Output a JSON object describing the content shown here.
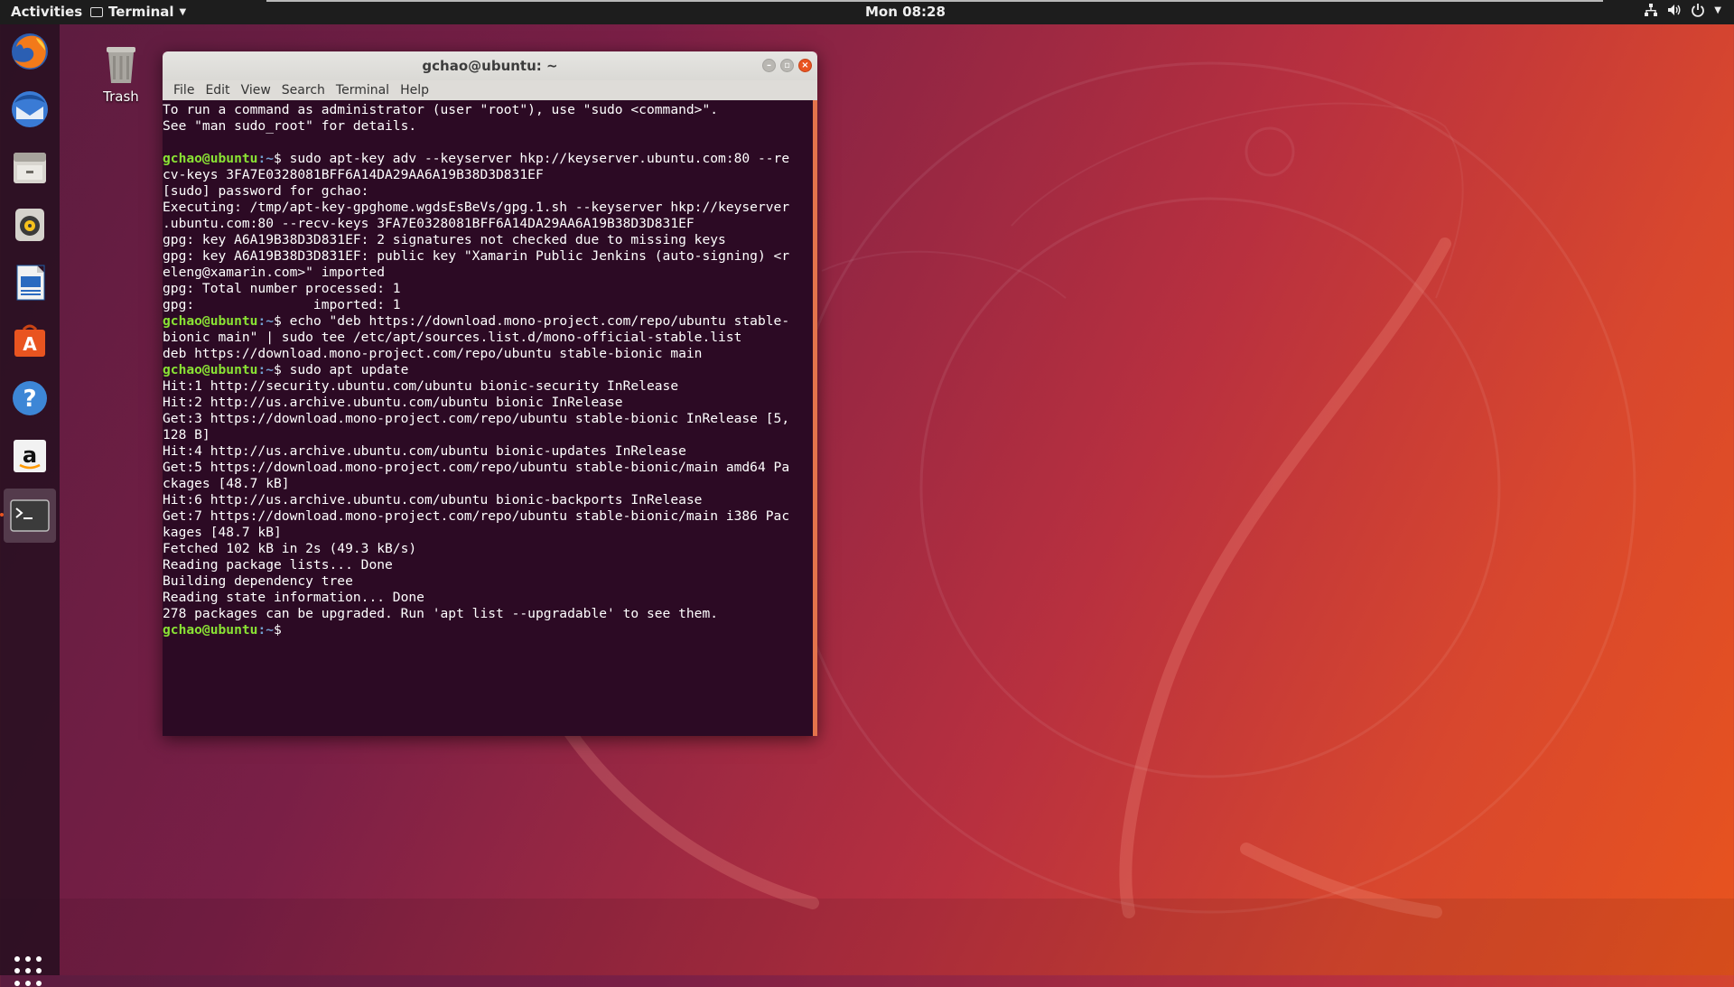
{
  "topbar": {
    "activities": "Activities",
    "app_menu": "Terminal",
    "clock": "Mon 08:28"
  },
  "desktop": {
    "trash_label": "Trash"
  },
  "dock": {
    "items": [
      "Firefox Web Browser",
      "Thunderbird Mail",
      "Files",
      "Rhythmbox",
      "LibreOffice Writer",
      "Ubuntu Software",
      "Help",
      "Amazon",
      "Terminal"
    ]
  },
  "terminal": {
    "title": "gchao@ubuntu: ~",
    "menu": [
      "File",
      "Edit",
      "View",
      "Search",
      "Terminal",
      "Help"
    ],
    "prompt_user": "gchao@ubuntu",
    "prompt_path": ":~",
    "lines": [
      {
        "type": "out",
        "text": "To run a command as administrator (user \"root\"), use \"sudo <command>\"."
      },
      {
        "type": "out",
        "text": "See \"man sudo_root\" for details."
      },
      {
        "type": "out",
        "text": ""
      },
      {
        "type": "cmd",
        "text": "$ sudo apt-key adv --keyserver hkp://keyserver.ubuntu.com:80 --re"
      },
      {
        "type": "out",
        "text": "cv-keys 3FA7E0328081BFF6A14DA29AA6A19B38D3D831EF"
      },
      {
        "type": "out",
        "text": "[sudo] password for gchao:"
      },
      {
        "type": "out",
        "text": "Executing: /tmp/apt-key-gpghome.wgdsEsBeVs/gpg.1.sh --keyserver hkp://keyserver"
      },
      {
        "type": "out",
        "text": ".ubuntu.com:80 --recv-keys 3FA7E0328081BFF6A14DA29AA6A19B38D3D831EF"
      },
      {
        "type": "out",
        "text": "gpg: key A6A19B38D3D831EF: 2 signatures not checked due to missing keys"
      },
      {
        "type": "out",
        "text": "gpg: key A6A19B38D3D831EF: public key \"Xamarin Public Jenkins (auto-signing) <r"
      },
      {
        "type": "out",
        "text": "eleng@xamarin.com>\" imported"
      },
      {
        "type": "out",
        "text": "gpg: Total number processed: 1"
      },
      {
        "type": "out",
        "text": "gpg:               imported: 1"
      },
      {
        "type": "cmd",
        "text": "$ echo \"deb https://download.mono-project.com/repo/ubuntu stable-"
      },
      {
        "type": "out",
        "text": "bionic main\" | sudo tee /etc/apt/sources.list.d/mono-official-stable.list"
      },
      {
        "type": "out",
        "text": "deb https://download.mono-project.com/repo/ubuntu stable-bionic main"
      },
      {
        "type": "cmd",
        "text": "$ sudo apt update"
      },
      {
        "type": "out",
        "text": "Hit:1 http://security.ubuntu.com/ubuntu bionic-security InRelease"
      },
      {
        "type": "out",
        "text": "Hit:2 http://us.archive.ubuntu.com/ubuntu bionic InRelease"
      },
      {
        "type": "out",
        "text": "Get:3 https://download.mono-project.com/repo/ubuntu stable-bionic InRelease [5,"
      },
      {
        "type": "out",
        "text": "128 B]"
      },
      {
        "type": "out",
        "text": "Hit:4 http://us.archive.ubuntu.com/ubuntu bionic-updates InRelease"
      },
      {
        "type": "out",
        "text": "Get:5 https://download.mono-project.com/repo/ubuntu stable-bionic/main amd64 Pa"
      },
      {
        "type": "out",
        "text": "ckages [48.7 kB]"
      },
      {
        "type": "out",
        "text": "Hit:6 http://us.archive.ubuntu.com/ubuntu bionic-backports InRelease"
      },
      {
        "type": "out",
        "text": "Get:7 https://download.mono-project.com/repo/ubuntu stable-bionic/main i386 Pac"
      },
      {
        "type": "out",
        "text": "kages [48.7 kB]"
      },
      {
        "type": "out",
        "text": "Fetched 102 kB in 2s (49.3 kB/s)"
      },
      {
        "type": "out",
        "text": "Reading package lists... Done"
      },
      {
        "type": "out",
        "text": "Building dependency tree"
      },
      {
        "type": "out",
        "text": "Reading state information... Done"
      },
      {
        "type": "out",
        "text": "278 packages can be upgraded. Run 'apt list --upgradable' to see them."
      },
      {
        "type": "cmd",
        "text": "$ "
      }
    ]
  },
  "colors": {
    "ubuntu_orange": "#e95420",
    "terminal_bg": "#2c0a24",
    "prompt_green": "#8ae234",
    "path_blue": "#729fcf"
  }
}
